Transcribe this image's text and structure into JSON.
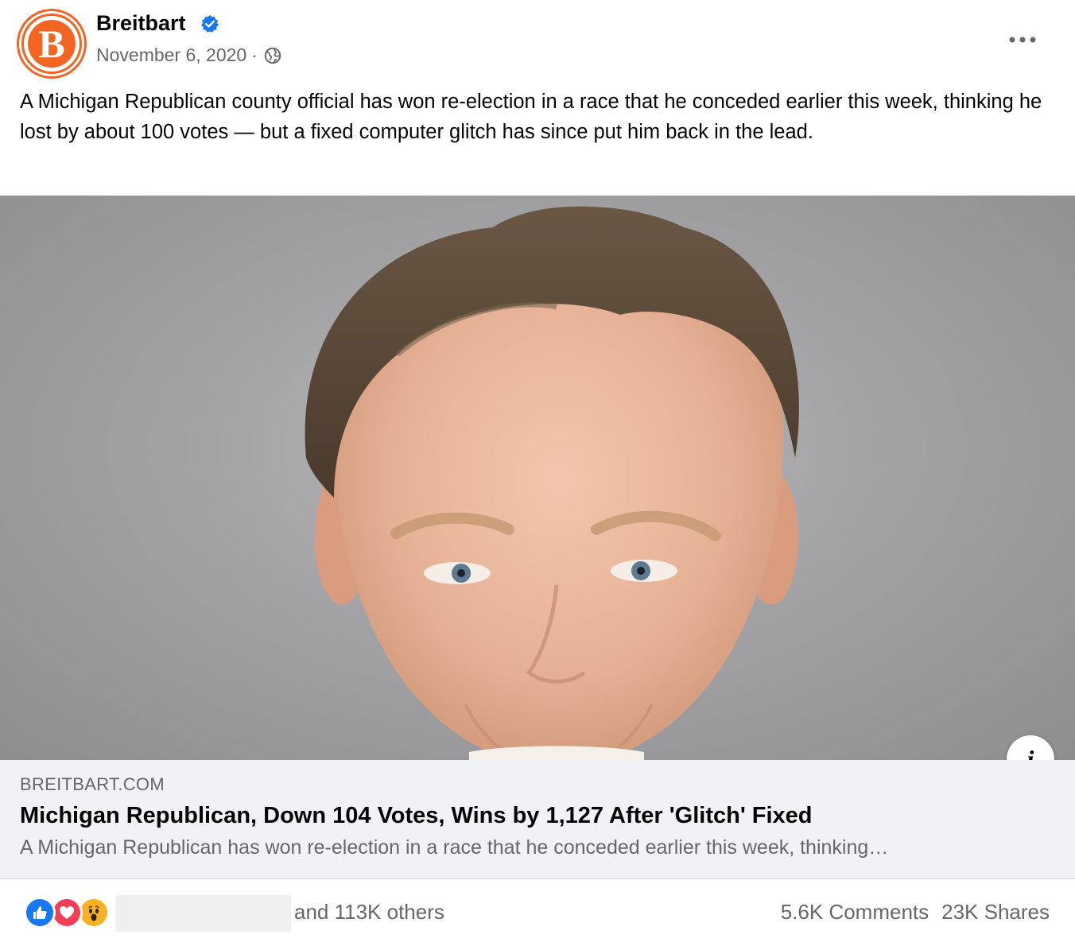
{
  "post": {
    "page_name": "Breitbart",
    "avatar_letter": "B",
    "date": "November 6, 2020",
    "separator": "·",
    "caption": "A Michigan Republican county official has won re-election in a race that he conceded earlier this week, thinking he lost by about 100 votes — but a fixed computer glitch has since put him back in the lead."
  },
  "link_preview": {
    "domain": "BREITBART.COM",
    "title": "Michigan Republican, Down 104 Votes, Wins by 1,127 After 'Glitch' Fixed",
    "description": "A Michigan Republican has won re-election in a race that he conceded earlier this week, thinking…",
    "info_glyph": "i"
  },
  "engagement": {
    "reactions": [
      "like-icon",
      "love-icon",
      "wow-icon"
    ],
    "others_text": "and 113K others",
    "comments": "5.6K Comments",
    "shares": "23K Shares"
  },
  "colors": {
    "brand_orange": "#f26522",
    "verified_blue": "#1877f2",
    "like_blue": "#1877f2",
    "love_red": "#f33e58",
    "wow_yellow": "#f7b125",
    "muted_text": "#65676b",
    "card_bg": "#f0f2f5"
  },
  "icons": {
    "verified": "verified-badge-icon",
    "privacy": "globe-icon",
    "more": "more-options-icon",
    "info": "info-icon"
  }
}
